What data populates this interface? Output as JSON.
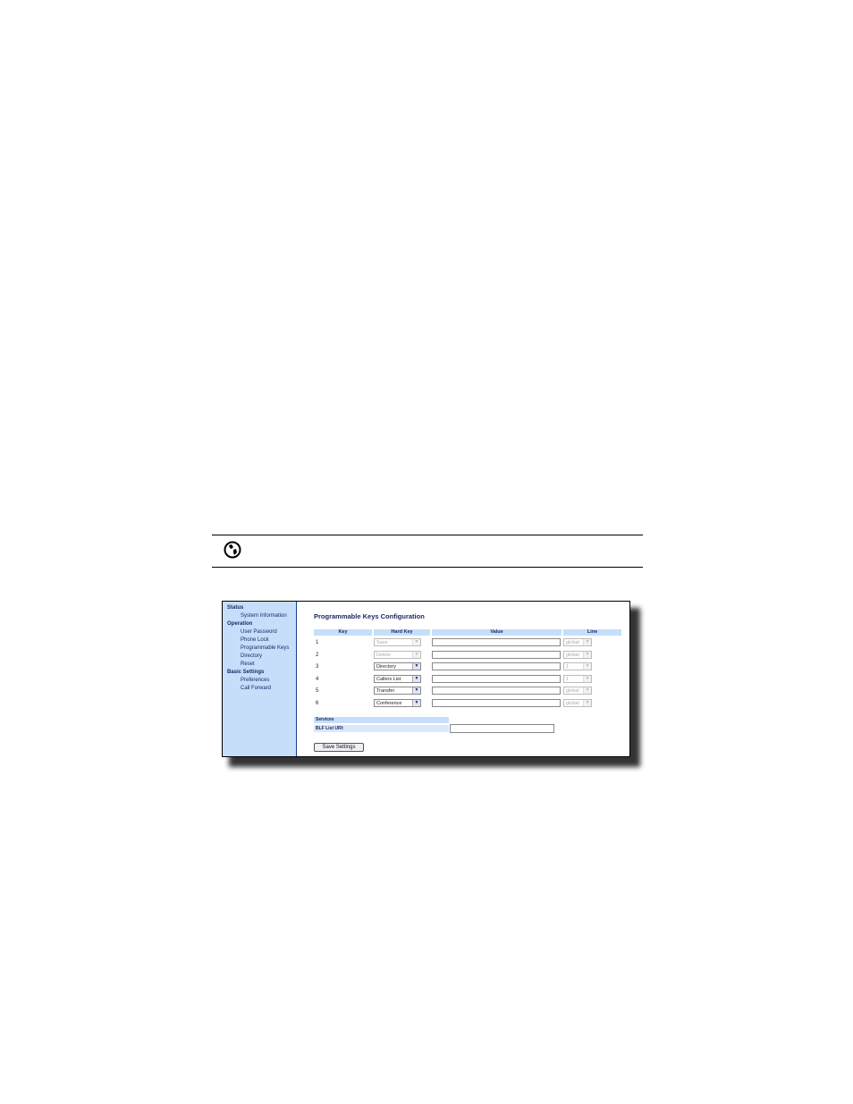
{
  "sidebar": {
    "sections": [
      {
        "label": "Status",
        "items": [
          "System Information"
        ]
      },
      {
        "label": "Operation",
        "items": [
          "User Password",
          "Phone Lock",
          "Programmable Keys",
          "Directory",
          "Reset"
        ]
      },
      {
        "label": "Basic Settings",
        "items": [
          "Preferences",
          "Call Forward"
        ]
      }
    ]
  },
  "main": {
    "title": "Programmable Keys Configuration",
    "columns": {
      "key": "Key",
      "hard_key": "Hard Key",
      "value": "Value",
      "line": "Line"
    },
    "rows": [
      {
        "key": "1",
        "hard_key": "Save",
        "hard_key_disabled": true,
        "value": "",
        "line": "global"
      },
      {
        "key": "2",
        "hard_key": "Delete",
        "hard_key_disabled": true,
        "value": "",
        "line": "global"
      },
      {
        "key": "3",
        "hard_key": "Directory",
        "hard_key_disabled": false,
        "value": "",
        "line": "1"
      },
      {
        "key": "4",
        "hard_key": "Callers List",
        "hard_key_disabled": false,
        "value": "",
        "line": "1"
      },
      {
        "key": "5",
        "hard_key": "Transfer",
        "hard_key_disabled": false,
        "value": "",
        "line": "global"
      },
      {
        "key": "6",
        "hard_key": "Conference",
        "hard_key_disabled": false,
        "value": "",
        "line": "global"
      }
    ],
    "services": {
      "header": "Services",
      "blf_label": "BLF List URI:",
      "blf_value": ""
    },
    "save_label": "Save Settings"
  },
  "colors": {
    "sidebar_bg": "#c6defa",
    "header_bg": "#c6defa",
    "text": "#1b2a66"
  }
}
